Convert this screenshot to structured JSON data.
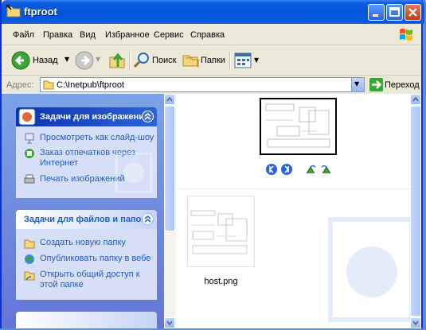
{
  "window": {
    "title": "ftproot"
  },
  "menu": [
    "Файл",
    "Правка",
    "Вид",
    "Избранное",
    "Сервис",
    "Справка"
  ],
  "toolbar": {
    "back_label": "Назад",
    "search_label": "Поиск",
    "folders_label": "Папки"
  },
  "address": {
    "label": "Адрес:",
    "value": "C:\\Inetpub\\ftproot",
    "go_label": "Переход"
  },
  "tasks": {
    "image_panel": {
      "title": "Задачи для изображений",
      "links": [
        {
          "label": "Просмотреть как слайд-шоу",
          "icon": "slideshow-icon"
        },
        {
          "label": "Заказ отпечатков через Интернет",
          "icon": "order-prints-icon"
        },
        {
          "label": "Печать изображений",
          "icon": "print-icon"
        }
      ]
    },
    "file_panel": {
      "title": "Задачи для файлов и папок",
      "links": [
        {
          "label": "Создать новую папку",
          "icon": "new-folder-icon"
        },
        {
          "label": "Опубликовать папку в вебе",
          "icon": "publish-web-icon"
        },
        {
          "label": "Открыть общий доступ к этой папке",
          "icon": "share-folder-icon"
        }
      ]
    }
  },
  "files": [
    {
      "name": "host.png"
    }
  ],
  "colors": {
    "titlebar": "#0355da",
    "task_pane": "#6f8ee0",
    "link": "#215dc6"
  }
}
